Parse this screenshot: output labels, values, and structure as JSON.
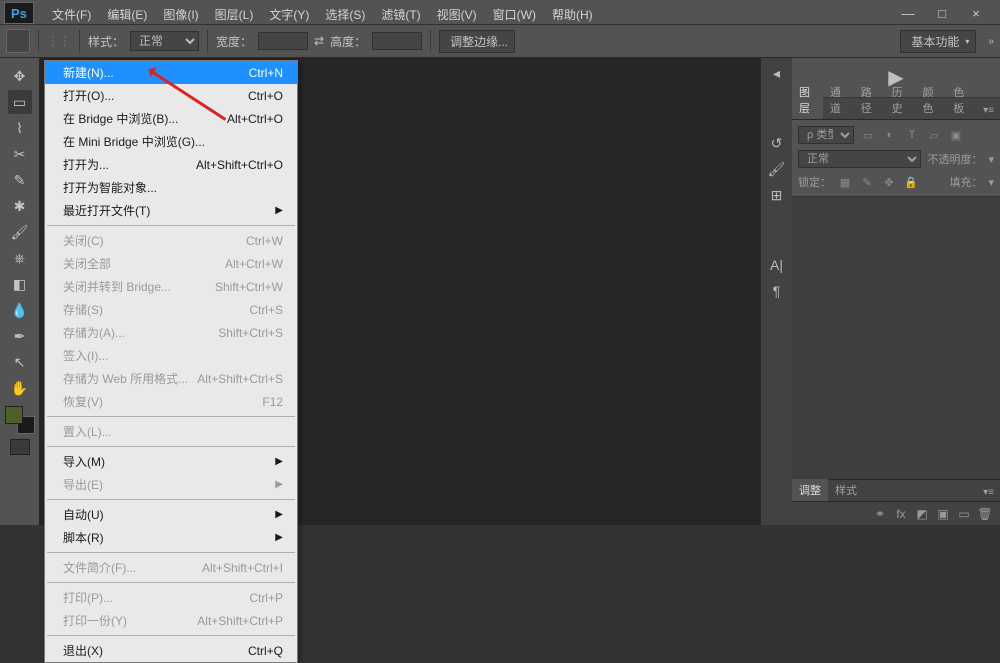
{
  "window": {
    "min": "—",
    "max": "□",
    "close": "×"
  },
  "menus": [
    "文件(F)",
    "编辑(E)",
    "图像(I)",
    "图层(L)",
    "文字(Y)",
    "选择(S)",
    "滤镜(T)",
    "视图(V)",
    "窗口(W)",
    "帮助(H)"
  ],
  "options": {
    "style_label": "样式：",
    "style_value": "正常",
    "width_label": "宽度：",
    "swap": "⇄",
    "height_label": "高度：",
    "refine": "调整边缘...",
    "workspace": "基本功能"
  },
  "file_menu": [
    {
      "label": "新建(N)...",
      "shortcut": "Ctrl+N",
      "hl": true
    },
    {
      "label": "打开(O)...",
      "shortcut": "Ctrl+O"
    },
    {
      "label": "在 Bridge 中浏览(B)...",
      "shortcut": "Alt+Ctrl+O"
    },
    {
      "label": "在 Mini Bridge 中浏览(G)..."
    },
    {
      "label": "打开为...",
      "shortcut": "Alt+Shift+Ctrl+O"
    },
    {
      "label": "打开为智能对象..."
    },
    {
      "label": "最近打开文件(T)",
      "sub": true
    },
    {
      "sep": true
    },
    {
      "label": "关闭(C)",
      "shortcut": "Ctrl+W",
      "dis": true
    },
    {
      "label": "关闭全部",
      "shortcut": "Alt+Ctrl+W",
      "dis": true
    },
    {
      "label": "关闭并转到 Bridge...",
      "shortcut": "Shift+Ctrl+W",
      "dis": true
    },
    {
      "label": "存储(S)",
      "shortcut": "Ctrl+S",
      "dis": true
    },
    {
      "label": "存储为(A)...",
      "shortcut": "Shift+Ctrl+S",
      "dis": true
    },
    {
      "label": "签入(I)...",
      "dis": true
    },
    {
      "label": "存储为 Web 所用格式...",
      "shortcut": "Alt+Shift+Ctrl+S",
      "dis": true
    },
    {
      "label": "恢复(V)",
      "shortcut": "F12",
      "dis": true
    },
    {
      "sep": true
    },
    {
      "label": "置入(L)...",
      "dis": true
    },
    {
      "sep": true
    },
    {
      "label": "导入(M)",
      "sub": true
    },
    {
      "label": "导出(E)",
      "sub": true,
      "dis": true
    },
    {
      "sep": true
    },
    {
      "label": "自动(U)",
      "sub": true
    },
    {
      "label": "脚本(R)",
      "sub": true
    },
    {
      "sep": true
    },
    {
      "label": "文件简介(F)...",
      "shortcut": "Alt+Shift+Ctrl+I",
      "dis": true
    },
    {
      "sep": true
    },
    {
      "label": "打印(P)...",
      "shortcut": "Ctrl+P",
      "dis": true
    },
    {
      "label": "打印一份(Y)",
      "shortcut": "Alt+Shift+Ctrl+P",
      "dis": true
    },
    {
      "sep": true
    },
    {
      "label": "退出(X)",
      "shortcut": "Ctrl+Q"
    }
  ],
  "layers": {
    "tabs": [
      "图层",
      "通道",
      "路径",
      "历史",
      "颜色",
      "色板"
    ],
    "kind": "ρ 类型",
    "blend": "正常",
    "opacity_label": "不透明度：",
    "lock_label": "锁定：",
    "fill_label": "填充："
  },
  "bottom": {
    "tabs": [
      "调整",
      "样式"
    ]
  }
}
